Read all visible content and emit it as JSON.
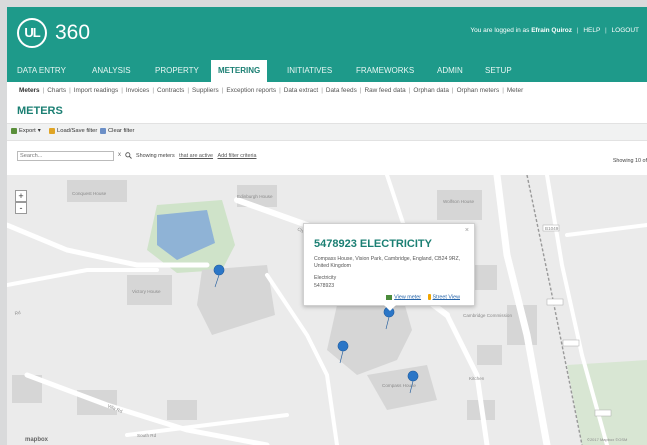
{
  "header": {
    "logo_badge": "UL",
    "logo_number": "360",
    "logged_in_prefix": "You are logged in as",
    "user_name": "Efrain Quiroz",
    "help_label": "HELP",
    "logout_label": "LOGOUT"
  },
  "nav": [
    {
      "label": "DATA ENTRY",
      "active": false
    },
    {
      "label": "ANALYSIS",
      "active": false
    },
    {
      "label": "PROPERTY",
      "active": false
    },
    {
      "label": "METERING",
      "active": true
    },
    {
      "label": "INITIATIVES",
      "active": false
    },
    {
      "label": "FRAMEWORKS",
      "active": false
    },
    {
      "label": "ADMIN",
      "active": false
    },
    {
      "label": "SETUP",
      "active": false
    }
  ],
  "subnav": [
    {
      "label": "Meters",
      "active": true
    },
    {
      "label": "Charts"
    },
    {
      "label": "Import readings"
    },
    {
      "label": "Invoices"
    },
    {
      "label": "Contracts"
    },
    {
      "label": "Suppliers"
    },
    {
      "label": "Exception reports"
    },
    {
      "label": "Data extract"
    },
    {
      "label": "Data feeds"
    },
    {
      "label": "Raw feed data"
    },
    {
      "label": "Orphan data"
    },
    {
      "label": "Orphan meters"
    },
    {
      "label": "Meter"
    }
  ],
  "page": {
    "title": "METERS"
  },
  "toolbar": {
    "export_label": "Export",
    "load_save_label": "Load/Save filter",
    "clear_label": "Clear filter"
  },
  "filter": {
    "search_placeholder": "Search...",
    "clear_symbol": "x",
    "showing_label": "Showing meters",
    "not_archived_link": "that are active",
    "add_filter_link": "Add filter criteria",
    "showing_count": "Showing 10 of"
  },
  "map": {
    "labels": {
      "conquest_house": "Conquest House",
      "edinburgh_house": "Edinburgh House",
      "wolfson_house": "Wolfson House",
      "victory_house": "Victory House",
      "chesney_way": "Chesney Way",
      "compass_house": "Compass House",
      "road_1": "Rd",
      "villa_rd": "Villa Rd",
      "south_rd": "South Rd",
      "depot": "Kitchen",
      "cambridge_house": "Cambridge Commission",
      "b1049": "B1049",
      "map_credit": "mapbox"
    },
    "zoom_in": "+",
    "zoom_out": "-",
    "attribution": "©2017 Mapbox ©OSM"
  },
  "popup": {
    "title": "5478923 ELECTRICITY",
    "address": "Compass House, Vision Park, Cambridge, England, CB24 9RZ, United Kingdom",
    "type": "Electricity",
    "id": "5478923",
    "view_meter": "View meter",
    "street_view": "Street View",
    "close": "×"
  },
  "colors": {
    "brand": "#1e9a8a",
    "brand_dark": "#1b7f73",
    "pin": "#2b76c7",
    "park": "#cfe3c9",
    "water": "#8fb3d6"
  }
}
